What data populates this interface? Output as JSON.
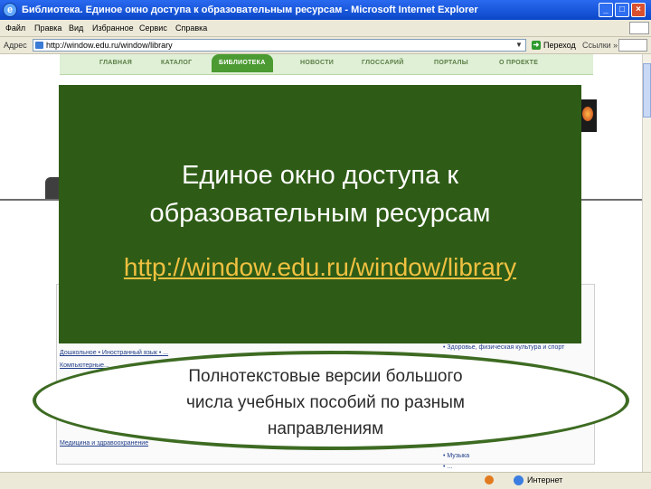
{
  "window": {
    "title": "Библиотека. Единое окно доступа к образовательным ресурсам - Microsoft Internet Explorer",
    "minimize": "_",
    "maximize": "□",
    "close": "×"
  },
  "menu": [
    "Файл",
    "Правка",
    "Вид",
    "Избранное",
    "Сервис",
    "Справка"
  ],
  "address": {
    "label": "Адрес",
    "url": "http://window.edu.ru/window/library",
    "go_label": "Переход",
    "links_label": "Ссылки »"
  },
  "site_nav": [
    "ГЛАВНАЯ",
    "КАТАЛОГ",
    "БИБЛИОТЕКА",
    "НОВОСТИ",
    "ГЛОССАРИЙ",
    "ПОРТАЛЫ",
    "О ПРОЕКТЕ"
  ],
  "site_nav_active": "БИБЛИОТЕКА",
  "page_links": {
    "row1": "Дошкольное • Иностранный язык • ...",
    "row2": "Компьютерные...",
    "row3": "Медицина и здравоохранение",
    "right1": "• Здоровье, физическая культура и спорт",
    "right2": "• Музыка",
    "right3": "• ..."
  },
  "slide": {
    "title_line1": "Единое окно доступа к",
    "title_line2": "образовательным ресурсам",
    "url": "http://window.edu.ru/window/library",
    "callout_line1": "Полнотекстовые версии большого",
    "callout_line2": "числа учебных пособий по разным",
    "callout_line3": "направлениям"
  },
  "status": {
    "zone": "Интернет"
  },
  "colors": {
    "slide_green": "#2e5c16",
    "url_color": "#f0c040",
    "ellipse_border": "#3d6b22",
    "titlebar_blue": "#0b47c8"
  }
}
